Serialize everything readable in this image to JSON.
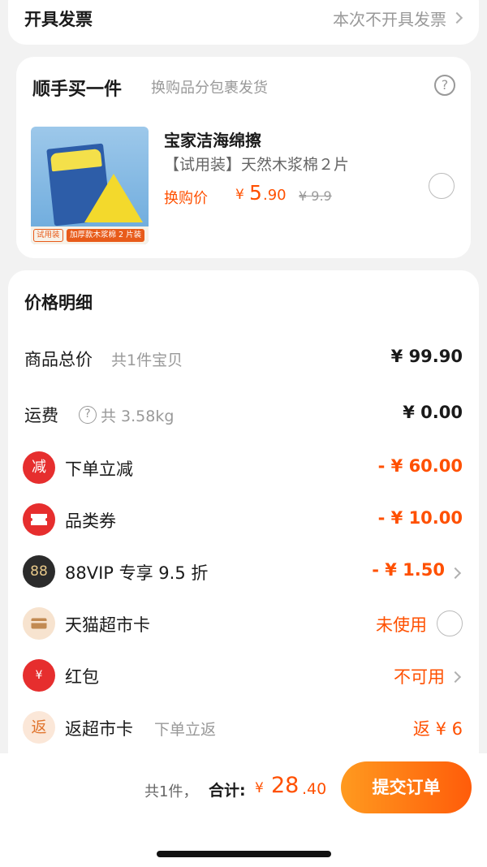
{
  "invoice": {
    "label": "开具发票",
    "value": "本次不开具发票"
  },
  "addon": {
    "title": "顺手买一件",
    "subtitle": "换购品分包裹发货",
    "help": "?",
    "product_name": "宝家洁海绵擦",
    "product_desc": "【试用装】天然木浆棉２片",
    "price_label": "换购价",
    "price_currency": "¥",
    "price_int": "5",
    "price_dec": ".90",
    "price_old": "¥ 9.9",
    "thumb_tag_a": "试用装",
    "thumb_tag_b": "加厚款木浆棉 2 片装"
  },
  "detail": {
    "title": "价格明细",
    "goods_total_label": "商品总价",
    "goods_total_sub": "共1件宝贝",
    "goods_total_amt": "¥ 99.90",
    "shipping_label": "运费",
    "shipping_sub": "共 3.58kg",
    "shipping_amt": "¥ 0.00",
    "instant_icon": "减",
    "instant_label": "下单立减",
    "instant_amt": "- ¥ 60.00",
    "category_label": "品类券",
    "category_amt": "- ¥ 10.00",
    "vip_icon": "88",
    "vip_label": "88VIP 专享 9.5 折",
    "vip_amt": "- ¥ 1.50",
    "card_label": "天猫超市卡",
    "card_status": "未使用",
    "redpacket_icon": "¥",
    "redpacket_label": "红包",
    "redpacket_status": "不可用",
    "rebate_icon": "返",
    "rebate_label": "返超市卡",
    "rebate_sub": "下单立返",
    "rebate_amt": "返 ¥ 6"
  },
  "bottom": {
    "count": "共1件，",
    "total_label": "合计:",
    "currency": "¥",
    "total_int": "28",
    "total_dec": ".40",
    "submit_label": "提交订单"
  },
  "colors": {
    "accent": "#ff5000",
    "red_icon": "#e62e2e",
    "vip_icon": "#2b2b2b"
  }
}
